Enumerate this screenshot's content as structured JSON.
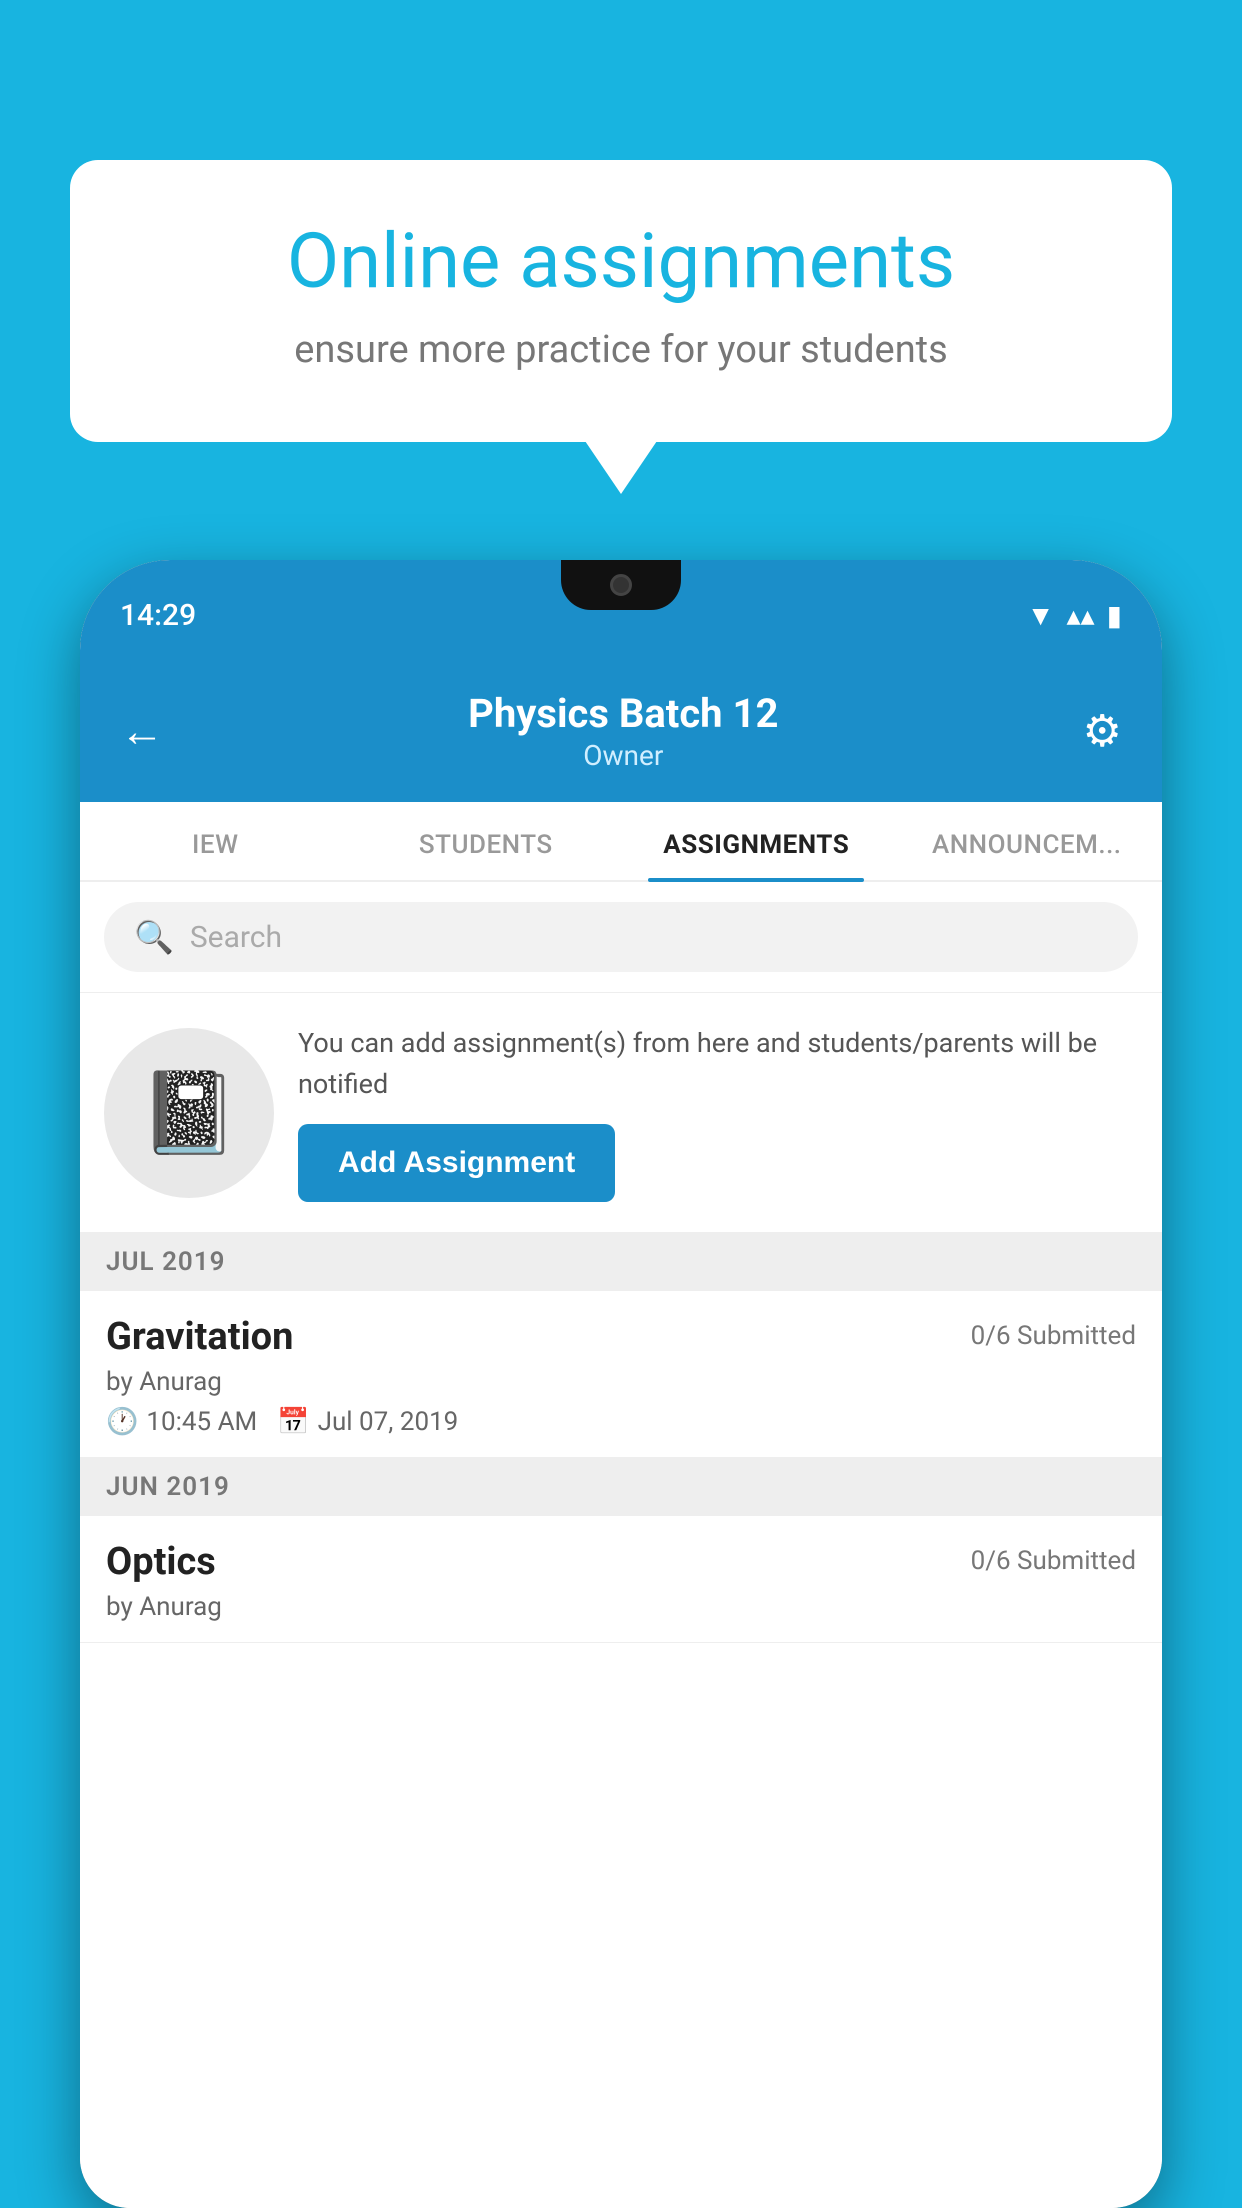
{
  "background": {
    "color": "#18b4e0"
  },
  "speech_bubble": {
    "title": "Online assignments",
    "subtitle": "ensure more practice for your students"
  },
  "phone": {
    "status_bar": {
      "time": "14:29",
      "wifi": "▾",
      "signal": "▲",
      "battery": "▐"
    },
    "header": {
      "title": "Physics Batch 12",
      "subtitle": "Owner",
      "back_label": "←",
      "settings_label": "⚙"
    },
    "tabs": [
      {
        "label": "IEW",
        "active": false
      },
      {
        "label": "STUDENTS",
        "active": false
      },
      {
        "label": "ASSIGNMENTS",
        "active": true
      },
      {
        "label": "ANNOUNCEM...",
        "active": false
      }
    ],
    "search": {
      "placeholder": "Search"
    },
    "promo": {
      "description": "You can add assignment(s) from here and students/parents will be notified",
      "button_label": "Add Assignment"
    },
    "sections": [
      {
        "label": "JUL 2019",
        "assignments": [
          {
            "name": "Gravitation",
            "submitted": "0/6 Submitted",
            "by": "by Anurag",
            "time": "10:45 AM",
            "date": "Jul 07, 2019"
          }
        ]
      },
      {
        "label": "JUN 2019",
        "assignments": [
          {
            "name": "Optics",
            "submitted": "0/6 Submitted",
            "by": "by Anurag",
            "time": "",
            "date": ""
          }
        ]
      }
    ]
  }
}
